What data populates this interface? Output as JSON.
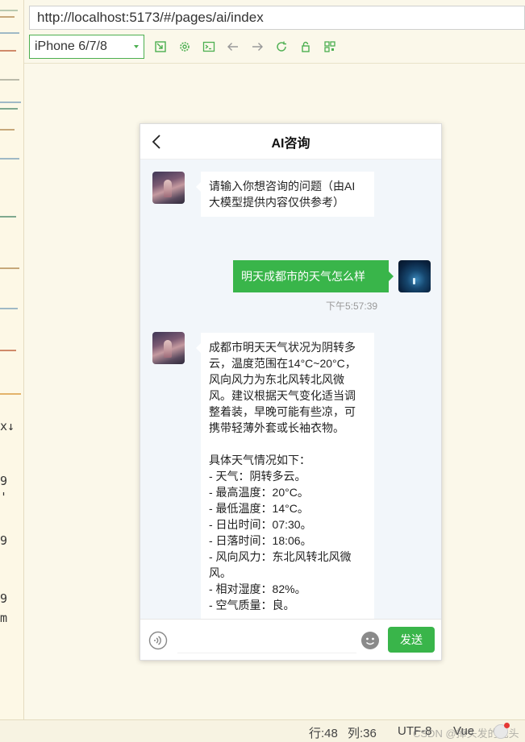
{
  "browser": {
    "url": "http://localhost:5173/#/pages/ai/index"
  },
  "toolbar": {
    "device": "iPhone 6/7/8",
    "icons": [
      "rotate-icon",
      "settings-icon",
      "console-icon",
      "back-arrow-icon",
      "forward-arrow-icon",
      "refresh-icon",
      "lock-icon",
      "qrcode-icon"
    ]
  },
  "editor_strip": {
    "glyphs": [
      "x↓",
      "9",
      "'",
      "9",
      "9",
      "m"
    ]
  },
  "page": {
    "title": "AI咨询"
  },
  "messages": [
    {
      "role": "ai",
      "text": "请输入你想咨询的问题（由AI大模型提供内容仅供参考）"
    },
    {
      "role": "user",
      "text": "明天成都市的天气怎么样",
      "time": "下午5:57:39"
    },
    {
      "role": "ai",
      "text": "成都市明天天气状况为阴转多云，温度范围在14°C~20°C，风向风力为东北风转北风微风。建议根据天气变化适当调整着装，早晚可能有些凉，可携带轻薄外套或长袖衣物。\n\n具体天气情况如下：\n- 天气：阴转多云。\n- 最高温度：20°C。\n- 最低温度：14°C。\n- 日出时间：07:30。\n- 日落时间：18:06。\n- 风向风力：东北风转北风微风。\n- 相对湿度：82%。\n- 空气质量：良。"
    }
  ],
  "input_bar": {
    "placeholder": "",
    "send_label": "发送"
  },
  "status_bar": {
    "line": "行:48",
    "col": "列:36",
    "encoding": "UTF-8",
    "language": "Vue",
    "watermark": "CSDN @掉头发的光头强"
  },
  "colors": {
    "accent": "#39b54a",
    "chat_bg": "#f2f6fa"
  }
}
